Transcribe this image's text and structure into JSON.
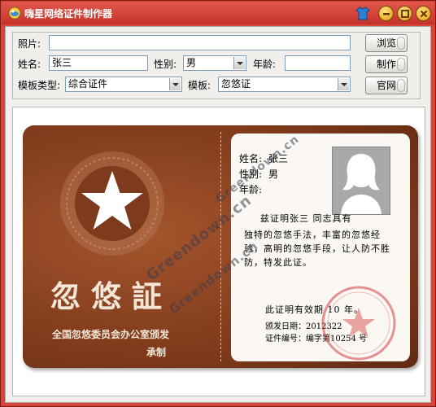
{
  "window": {
    "title": "嗨星网络证件制作器"
  },
  "form": {
    "photo_label": "照片:",
    "photo_value": "",
    "name_label": "姓名:",
    "name_value": "张三",
    "gender_label": "性别:",
    "gender_value": "男",
    "age_label": "年龄:",
    "age_value": "",
    "template_type_label": "模板类型:",
    "template_type_value": "综合证件",
    "template_label": "模板:",
    "template_value": "忽悠证"
  },
  "buttons": {
    "browse": "浏览",
    "make": "制作",
    "site": "官网"
  },
  "card": {
    "big_title": "忽悠証",
    "issuer": "全国忽悠委员会办公室颁发",
    "issuer2": "承制",
    "name_label": "姓名:",
    "name_value": "张三",
    "gender_label": "性别:",
    "gender_value": "男",
    "age_label": "年龄:",
    "certify_line": "兹证明张三    同志具有",
    "body": "独特的忽悠手法，丰富的忽悠经验，高明的忽悠手段，让人防不胜防，特发此证。",
    "validity": "此证明有效期 10 年。",
    "issue_date": "颁发日期：2012322",
    "cert_number": "证件编号：编字第10254 号"
  },
  "watermark": [
    "Greendown.cn",
    "Greendown.cn",
    "Greendown.cn"
  ]
}
